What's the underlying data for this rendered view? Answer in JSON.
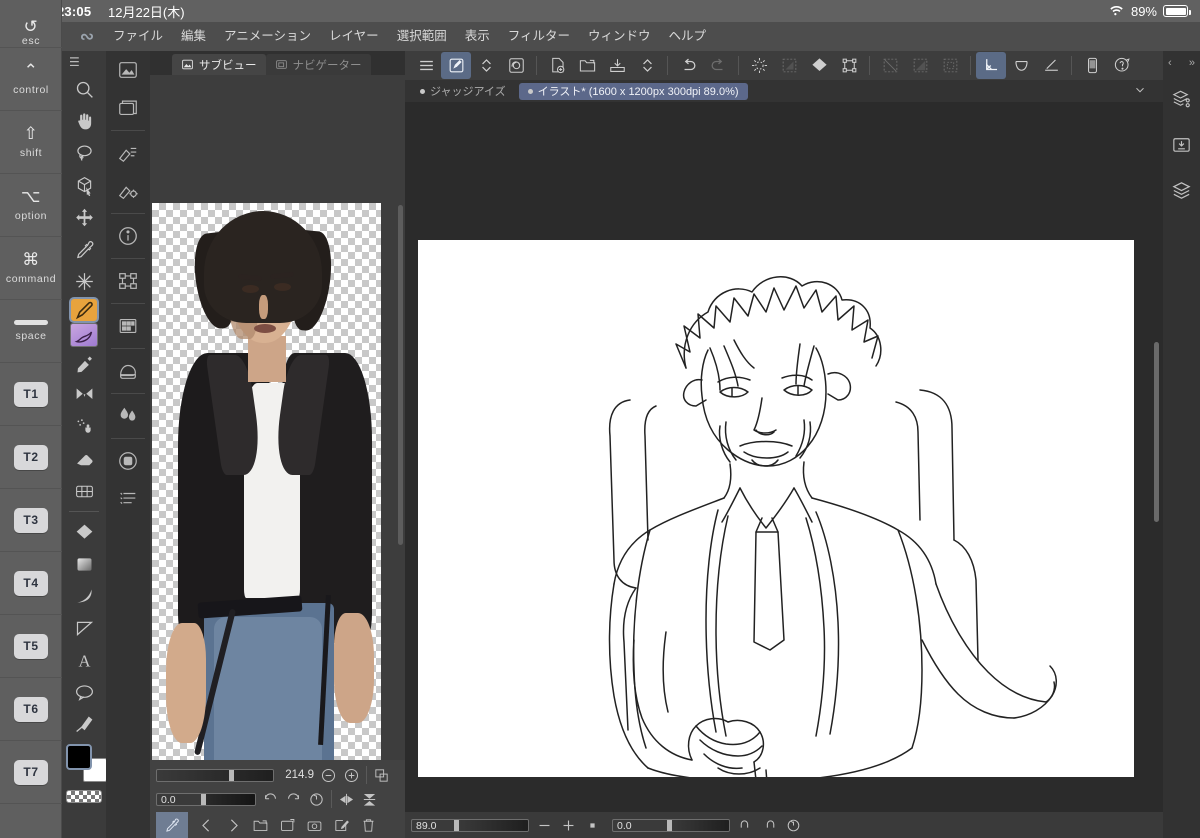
{
  "system": {
    "time": "23:05",
    "date": "12月22日(木)",
    "wifi_icon": "wifi-icon",
    "battery_percent": "89%",
    "battery_icon": "battery-icon"
  },
  "keyrail": {
    "keys": [
      {
        "label": "esc",
        "glyph": "↺",
        "type": "esc"
      },
      {
        "label": "control",
        "glyph": "⌃",
        "type": "mod"
      },
      {
        "label": "shift",
        "glyph": "⇧",
        "type": "mod"
      },
      {
        "label": "option",
        "glyph": "⌥",
        "type": "mod"
      },
      {
        "label": "command",
        "glyph": "⌘",
        "type": "mod"
      },
      {
        "label": "space",
        "glyph": "",
        "type": "space"
      },
      {
        "label": "T1",
        "glyph": "",
        "type": "tkey"
      },
      {
        "label": "T2",
        "glyph": "",
        "type": "tkey"
      },
      {
        "label": "T3",
        "glyph": "",
        "type": "tkey"
      },
      {
        "label": "T4",
        "glyph": "",
        "type": "tkey"
      },
      {
        "label": "T5",
        "glyph": "",
        "type": "tkey"
      },
      {
        "label": "T6",
        "glyph": "",
        "type": "tkey"
      },
      {
        "label": "T7",
        "glyph": "",
        "type": "tkey"
      }
    ]
  },
  "menubar": {
    "app_logo": "clip-studio-paint-logo",
    "items": [
      {
        "label": "ファイル"
      },
      {
        "label": "編集"
      },
      {
        "label": "アニメーション"
      },
      {
        "label": "レイヤー"
      },
      {
        "label": "選択範囲"
      },
      {
        "label": "表示"
      },
      {
        "label": "フィルター"
      },
      {
        "label": "ウィンドウ"
      },
      {
        "label": "ヘルプ"
      }
    ]
  },
  "tool_palette": {
    "menu_icon": "hamburger-icon",
    "tools": [
      {
        "name": "zoom-tool",
        "selected": false
      },
      {
        "name": "hand-tool",
        "selected": false
      },
      {
        "name": "lasso-select-tool",
        "selected": false
      },
      {
        "name": "object-select-tool",
        "selected": false
      },
      {
        "name": "move-tool",
        "selected": false
      },
      {
        "name": "eyedropper-tool",
        "selected": false
      },
      {
        "name": "magic-wand-tool",
        "selected": false
      },
      {
        "name": "pen-tool",
        "selected": true
      },
      {
        "name": "brush-tool",
        "selected": false
      },
      {
        "name": "airbrush-tool",
        "selected": false
      },
      {
        "name": "decoration-tool",
        "selected": false
      },
      {
        "name": "blend-tool",
        "selected": false
      },
      {
        "name": "eraser-tool",
        "selected": false
      },
      {
        "name": "gradient-grid-tool",
        "selected": false
      },
      {
        "name": "fill-tool",
        "selected": false
      },
      {
        "name": "gradient-tool",
        "selected": false
      },
      {
        "name": "figure-curve-tool",
        "selected": false
      },
      {
        "name": "ruler-tool",
        "selected": false
      },
      {
        "name": "text-tool",
        "selected": false
      },
      {
        "name": "balloon-tool",
        "selected": false
      },
      {
        "name": "correct-line-tool",
        "selected": false
      }
    ],
    "colors": {
      "foreground": "#000000",
      "background": "#ffffff",
      "transparent_label": "transparent-color"
    }
  },
  "secondary_column": {
    "icons": [
      {
        "name": "sub-view-icon"
      },
      {
        "name": "layer-preview-icon"
      },
      {
        "name": "brush-setting-icon"
      },
      {
        "name": "tool-property-icon"
      },
      {
        "name": "info-icon"
      },
      {
        "name": "node-editor-icon"
      },
      {
        "name": "material-grid-icon"
      },
      {
        "name": "color-wheel-icon"
      },
      {
        "name": "color-blend-icon"
      },
      {
        "name": "color-set-icon"
      },
      {
        "name": "history-icon"
      }
    ]
  },
  "subview": {
    "tabs": [
      {
        "label": "サブビュー",
        "icon": "image-icon",
        "active": true
      },
      {
        "label": "ナビゲーター",
        "icon": "navigator-icon",
        "active": false
      }
    ],
    "reference_image": "leather-jacket-man-photo",
    "toolbar": {
      "zoom_value": "214.9",
      "rotate_value": "0.0",
      "buttons": [
        {
          "name": "zoom-out-button",
          "icon": "minus-circle-icon"
        },
        {
          "name": "zoom-in-button",
          "icon": "plus-circle-icon"
        },
        {
          "name": "fit-to-screen-button",
          "icon": "fit-icon"
        },
        {
          "name": "rotate-left-button",
          "icon": "rotate-ccw-icon"
        },
        {
          "name": "rotate-right-button",
          "icon": "rotate-cw-icon"
        },
        {
          "name": "reset-rotation-button",
          "icon": "reset-rotate-icon"
        },
        {
          "name": "flip-horizontal-button",
          "icon": "flip-h-icon"
        },
        {
          "name": "flip-vertical-button",
          "icon": "flip-v-icon"
        },
        {
          "name": "eyedropper-toggle",
          "icon": "eyedropper-icon"
        },
        {
          "name": "previous-image-button",
          "icon": "chevron-left-icon"
        },
        {
          "name": "next-image-button",
          "icon": "chevron-right-icon"
        },
        {
          "name": "open-image-button",
          "icon": "folder-open-icon"
        },
        {
          "name": "add-image-button",
          "icon": "image-add-icon"
        },
        {
          "name": "camera-button",
          "icon": "camera-icon"
        },
        {
          "name": "edit-button",
          "icon": "edit-icon"
        },
        {
          "name": "delete-button",
          "icon": "trash-icon"
        }
      ]
    }
  },
  "editor": {
    "toolbar": [
      {
        "name": "command-bar-menu",
        "icon": "hamburger-icon",
        "state": "normal"
      },
      {
        "name": "quick-access-tool",
        "icon": "pen-square-icon",
        "state": "active"
      },
      {
        "name": "tool-swap-button",
        "icon": "chevron-updown-icon",
        "state": "normal"
      },
      {
        "name": "spiral-ruler-button",
        "icon": "spiral-icon",
        "state": "normal"
      },
      {
        "name": "new-document-button",
        "icon": "new-doc-icon",
        "state": "normal"
      },
      {
        "name": "open-file-button",
        "icon": "folder-open-icon",
        "state": "normal"
      },
      {
        "name": "save-file-button",
        "icon": "save-icon",
        "state": "normal"
      },
      {
        "name": "save-options-button",
        "icon": "chevron-updown-icon",
        "state": "normal"
      },
      {
        "name": "undo-button",
        "icon": "undo-icon",
        "state": "normal"
      },
      {
        "name": "redo-button",
        "icon": "redo-icon",
        "state": "dim"
      },
      {
        "name": "clear-button",
        "icon": "burst-icon",
        "state": "normal"
      },
      {
        "name": "fill-selection-button",
        "icon": "fill-selection-icon",
        "state": "dim"
      },
      {
        "name": "fill-button",
        "icon": "paint-bucket-icon",
        "state": "normal"
      },
      {
        "name": "transform-button",
        "icon": "transform-icon",
        "state": "normal"
      },
      {
        "name": "deselect-button",
        "icon": "deselect-icon",
        "state": "dim"
      },
      {
        "name": "invert-selection-button",
        "icon": "invert-selection-icon",
        "state": "dim"
      },
      {
        "name": "select-all-button",
        "icon": "select-all-icon",
        "state": "dim"
      },
      {
        "name": "vector-eraser-button",
        "icon": "vector-arrow-icon",
        "state": "active"
      },
      {
        "name": "smooth-curve-button",
        "icon": "curve-smooth-icon",
        "state": "normal"
      },
      {
        "name": "line-correct-button",
        "icon": "line-correct-icon",
        "state": "normal"
      },
      {
        "name": "mobile-preview-button",
        "icon": "tablet-icon",
        "state": "normal"
      },
      {
        "name": "help-button",
        "icon": "question-balloon-icon",
        "state": "normal"
      }
    ],
    "tabs": [
      {
        "label": "ジャッジアイズ",
        "active": false
      },
      {
        "label": "イラスト* (1600 x 1200px 300dpi 89.0%)",
        "active": true
      }
    ],
    "tab_overflow_icon": "chevron-down-icon",
    "canvas_artwork": "line-art-seated-man-in-suit",
    "statusbar": {
      "zoom_value": "89.0",
      "rotate_value": "0.0",
      "buttons": [
        {
          "name": "zoom-out-button",
          "icon": "minus-icon"
        },
        {
          "name": "zoom-in-button",
          "icon": "plus-icon"
        },
        {
          "name": "fit-button",
          "icon": "square-icon"
        },
        {
          "name": "rotate-left-button",
          "icon": "rotate-ccw-icon"
        },
        {
          "name": "rotate-right-button",
          "icon": "rotate-cw-icon"
        },
        {
          "name": "reset-view-button",
          "icon": "reset-rotate-icon"
        }
      ]
    }
  },
  "rightrail": {
    "collapse_left_icon": "chevron-left-icon",
    "collapse_right_icon": "chevron-double-right-icon",
    "icons": [
      {
        "name": "layer-property-icon"
      },
      {
        "name": "material-download-icon"
      },
      {
        "name": "layer-stack-icon"
      }
    ]
  }
}
